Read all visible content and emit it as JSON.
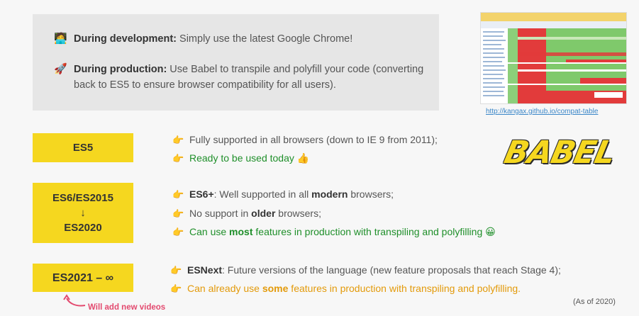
{
  "info": {
    "dev_emoji": "🧑‍💻",
    "dev_bold": "During development:",
    "dev_text": " Simply use the latest Google Chrome!",
    "prod_emoji": "🚀",
    "prod_bold": "During production:",
    "prod_text": " Use Babel to transpile and polyfill your code (converting back to ES5 to ensure browser compatibility for all users)."
  },
  "compat_link": "http://kangax.github.io/compat-table",
  "tags": {
    "es5": "ES5",
    "es6_line1": "ES6/ES2015",
    "es6_arrow": "↓",
    "es6_line2": "ES2020",
    "es2021": "ES2021 – ∞"
  },
  "hand_icon": "👉",
  "es5_bullets": {
    "b1": "Fully supported in all browsers (down to IE 9 from 2011);",
    "b2": "Ready to be used today 👍"
  },
  "es6_bullets": {
    "b1_bold": "ES6+",
    "b1_a": ": Well supported in all ",
    "b1_bold2": "modern",
    "b1_b": " browsers;",
    "b2_a": "No support in ",
    "b2_bold": "older",
    "b2_b": " browsers;",
    "b3_a": "Can use ",
    "b3_bold": "most",
    "b3_b": " features in production with transpiling and polyfilling 😀"
  },
  "es2021_bullets": {
    "b1_bold": "ESNext",
    "b1_a": ": Future versions of the language (new feature proposals that reach Stage 4);",
    "b2_a": "Can already use ",
    "b2_bold": "some",
    "b2_b": " features in production with transpiling and polyfilling."
  },
  "babel_logo": "BABEL",
  "note": "Will add new videos",
  "as_of": "(As of 2020)"
}
